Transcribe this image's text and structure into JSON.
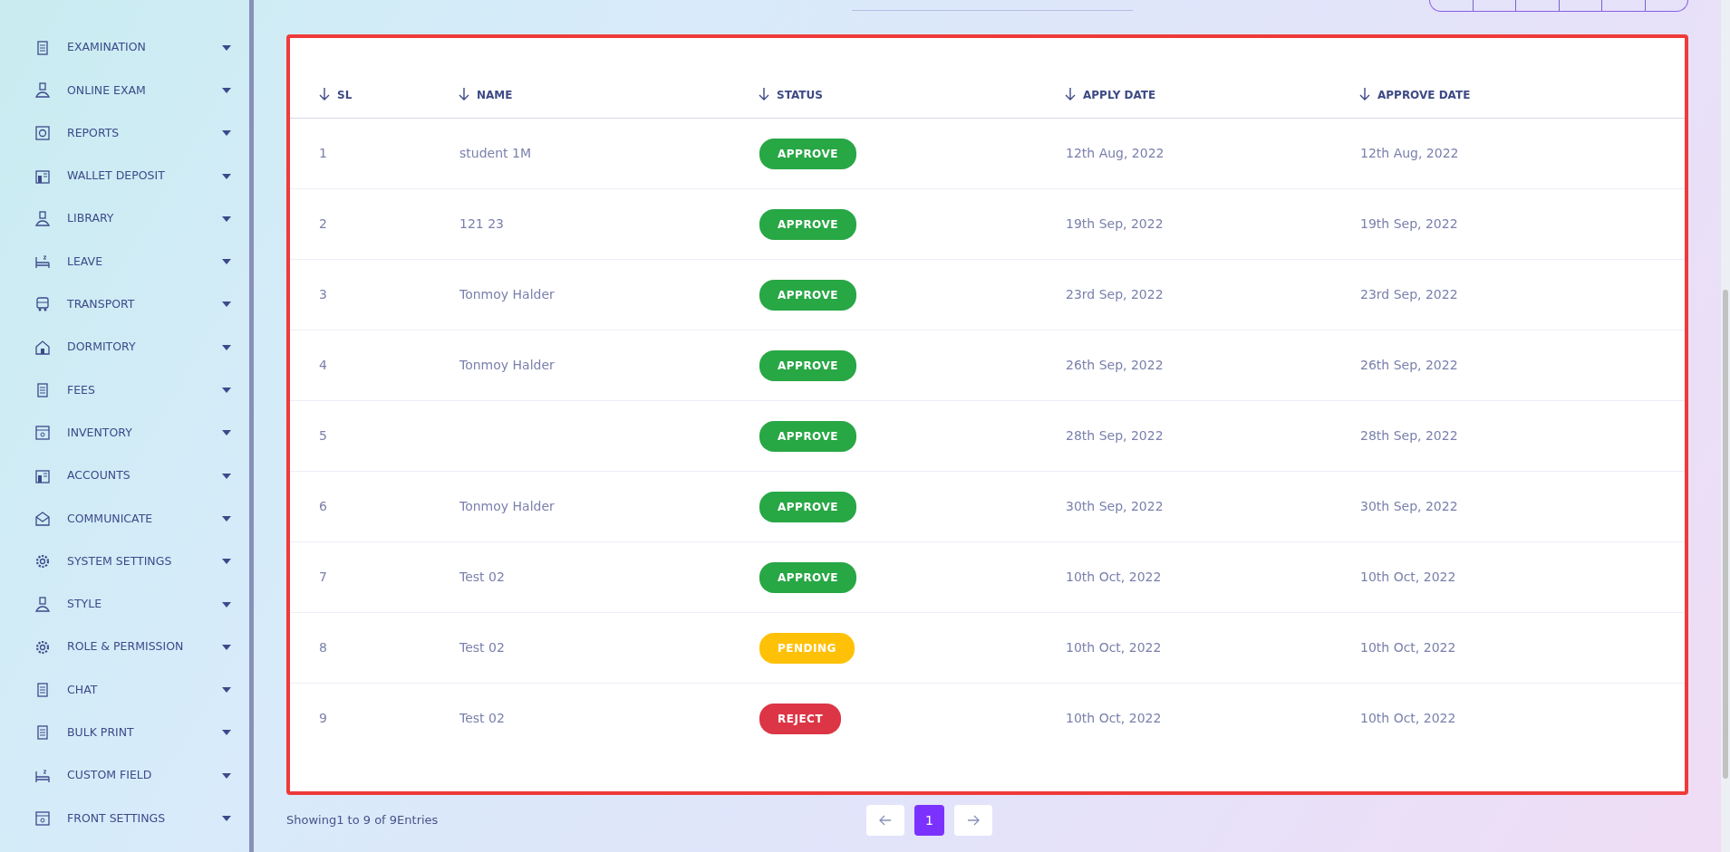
{
  "sidebar": {
    "items": [
      {
        "label": "EXAMINATION"
      },
      {
        "label": "ONLINE EXAM"
      },
      {
        "label": "REPORTS"
      },
      {
        "label": "WALLET DEPOSIT"
      },
      {
        "label": "LIBRARY"
      },
      {
        "label": "LEAVE"
      },
      {
        "label": "TRANSPORT"
      },
      {
        "label": "DORMITORY"
      },
      {
        "label": "FEES"
      },
      {
        "label": "INVENTORY"
      },
      {
        "label": "ACCOUNTS"
      },
      {
        "label": "COMMUNICATE"
      },
      {
        "label": "SYSTEM SETTINGS"
      },
      {
        "label": "STYLE"
      },
      {
        "label": "ROLE & PERMISSION"
      },
      {
        "label": "CHAT"
      },
      {
        "label": "BULK PRINT"
      },
      {
        "label": "CUSTOM FIELD"
      },
      {
        "label": "FRONT SETTINGS"
      }
    ]
  },
  "table": {
    "columns": [
      "SL",
      "NAME",
      "STATUS",
      "APPLY DATE",
      "APPROVE DATE"
    ],
    "rows": [
      {
        "sl": "1",
        "name": "student 1M",
        "status": "APPROVE",
        "kind": "approve",
        "apply_date": "12th Aug, 2022",
        "approve_date": "12th Aug, 2022"
      },
      {
        "sl": "2",
        "name": "121 23",
        "status": "APPROVE",
        "kind": "approve",
        "apply_date": "19th Sep, 2022",
        "approve_date": "19th Sep, 2022"
      },
      {
        "sl": "3",
        "name": "Tonmoy Halder",
        "status": "APPROVE",
        "kind": "approve",
        "apply_date": "23rd Sep, 2022",
        "approve_date": "23rd Sep, 2022"
      },
      {
        "sl": "4",
        "name": "Tonmoy Halder",
        "status": "APPROVE",
        "kind": "approve",
        "apply_date": "26th Sep, 2022",
        "approve_date": "26th Sep, 2022"
      },
      {
        "sl": "5",
        "status": "APPROVE",
        "kind": "approve",
        "apply_date": "28th Sep, 2022",
        "approve_date": "28th Sep, 2022"
      },
      {
        "sl": "6",
        "name": "Tonmoy Halder",
        "status": "APPROVE",
        "kind": "approve",
        "apply_date": "30th Sep, 2022",
        "approve_date": "30th Sep, 2022"
      },
      {
        "sl": "7",
        "name": "Test 02",
        "status": "APPROVE",
        "kind": "approve",
        "apply_date": "10th Oct, 2022",
        "approve_date": "10th Oct, 2022"
      },
      {
        "sl": "8",
        "name": "Test 02",
        "status": "PENDING",
        "kind": "pending",
        "apply_date": "10th Oct, 2022",
        "approve_date": "10th Oct, 2022"
      },
      {
        "sl": "9",
        "name": "Test 02",
        "status": "REJECT",
        "kind": "reject",
        "apply_date": "10th Oct, 2022",
        "approve_date": "10th Oct, 2022"
      }
    ]
  },
  "footer": {
    "info": "Showing1 to 9 of 9Entries",
    "pages": [
      {
        "label": "1",
        "selected": true
      }
    ]
  }
}
